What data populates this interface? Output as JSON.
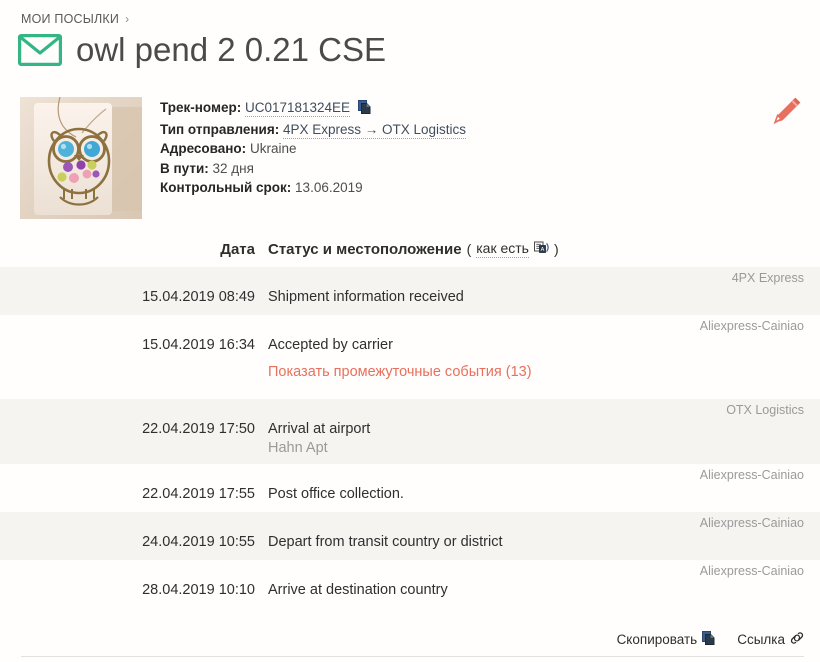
{
  "breadcrumb": {
    "label": "МОИ ПОСЫЛКИ",
    "separator": "›"
  },
  "header": {
    "title": "owl pend 2 0.21 CSE",
    "envelope_icon": "envelope-icon",
    "envelope_color": "#33b584",
    "edit_icon": "pencil-icon",
    "edit_color": "#e8705e"
  },
  "parcel": {
    "thumbnail_alt": "owl pendant necklace",
    "fields": [
      {
        "label": "Трек-номер:",
        "value": "UC017181324EE",
        "linkish": true,
        "copy_icon": "copy-icon"
      },
      {
        "label": "Тип отправления:",
        "value": "4PX Express → OTX Logistics",
        "linkish": true
      },
      {
        "label": "Адресовано:",
        "value": "Ukraine",
        "linkish": false
      },
      {
        "label": "В пути:",
        "value": "32 дня",
        "linkish": false
      },
      {
        "label": "Контрольный срок:",
        "value": "13.06.2019",
        "linkish": false
      }
    ]
  },
  "table": {
    "col_date": "Дата",
    "col_status": "Статус и местоположение",
    "paren_open": "(",
    "as_is_label": "как есть",
    "translate_icon": "translate-icon",
    "paren_close": ")",
    "rows": [
      {
        "date": "15.04.2019 08:49",
        "status": "Shipment information received",
        "sub": "",
        "carrier": "4PX Express",
        "shaded": true
      },
      {
        "date": "15.04.2019 16:34",
        "status": "Accepted by carrier",
        "sub": "",
        "carrier": "Aliexpress-Cainiao",
        "shaded": false
      },
      {
        "date": "22.04.2019 17:50",
        "status": "Arrival at airport",
        "sub": "Hahn Apt",
        "carrier": "OTX Logistics",
        "shaded": true
      },
      {
        "date": "22.04.2019 17:55",
        "status": "Post office collection.",
        "sub": "",
        "carrier": "Aliexpress-Cainiao",
        "shaded": false
      },
      {
        "date": "24.04.2019 10:55",
        "status": "Depart from transit country or district",
        "sub": "",
        "carrier": "Aliexpress-Cainiao",
        "shaded": true
      },
      {
        "date": "28.04.2019 10:10",
        "status": "Arrive at destination country",
        "sub": "",
        "carrier": "Aliexpress-Cainiao",
        "shaded": false
      }
    ],
    "expand_link": "Показать промежуточные события (13)",
    "expand_link_color": "#e8705e",
    "expand_after_row_index": 1
  },
  "footer": {
    "copy_label": "Скопировать",
    "copy_icon": "copy-icon",
    "link_label": "Ссылка",
    "link_icon": "link-icon"
  }
}
